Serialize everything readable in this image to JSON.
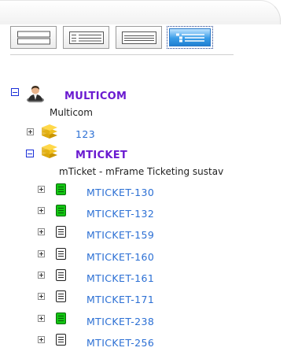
{
  "toolbar": {
    "buttons": [
      {
        "icon": "two-rows-view-icon",
        "selected": false
      },
      {
        "icon": "list-view-icon",
        "selected": false
      },
      {
        "icon": "compact-list-view-icon",
        "selected": false
      },
      {
        "icon": "tree-view-icon",
        "selected": true
      }
    ],
    "selected_color": "#3a9de8"
  },
  "tree": {
    "root": {
      "label": "MULTICOM",
      "description": "Multicom",
      "icon": "user-icon",
      "expanded": true
    },
    "projects": [
      {
        "label": "123",
        "icon": "folder-stack-icon",
        "expanded": false
      },
      {
        "label": "MTICKET",
        "description": "mTicket - mFrame Ticketing sustav",
        "icon": "folder-stack-icon",
        "expanded": true
      }
    ],
    "tickets": [
      {
        "label": "MTICKET-130",
        "status": "green"
      },
      {
        "label": "MTICKET-132",
        "status": "green"
      },
      {
        "label": "MTICKET-159",
        "status": "white"
      },
      {
        "label": "MTICKET-160",
        "status": "white"
      },
      {
        "label": "MTICKET-161",
        "status": "white"
      },
      {
        "label": "MTICKET-171",
        "status": "white"
      },
      {
        "label": "MTICKET-238",
        "status": "green"
      },
      {
        "label": "MTICKET-256",
        "status": "white"
      }
    ],
    "colors": {
      "project_label": "#6a1ad0",
      "link": "#2b6fd4",
      "status_green": "#12c412"
    }
  }
}
